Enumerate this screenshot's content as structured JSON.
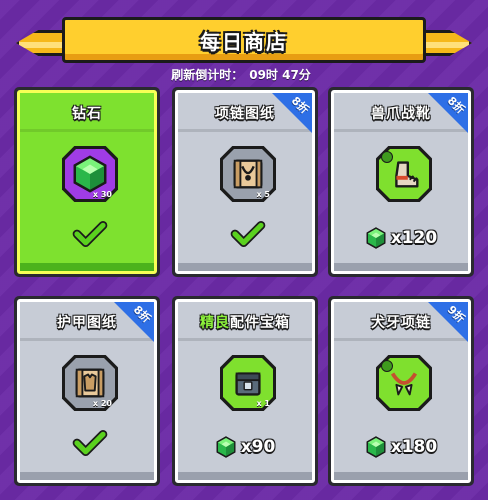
{
  "header": {
    "title": "每日商店",
    "refresh_label": "刷新倒计时：",
    "refresh_time": "09时 47分"
  },
  "colors": {
    "background": "#6b2aa6",
    "banner": "#ffcf2e",
    "selected_card": "#7ee12f",
    "card": "#c7ccd6",
    "discount_badge": "#2e6fe6"
  },
  "items": [
    {
      "title": "钻石",
      "quantity": "x 30",
      "icon": "gem-icon",
      "state": "claimed",
      "selected": true
    },
    {
      "title": "项链图纸",
      "quantity": "x 5",
      "icon": "necklace-blueprint-icon",
      "discount": "8折",
      "state": "claimed"
    },
    {
      "title": "兽爪战靴",
      "quantity": "",
      "icon": "claw-boots-icon",
      "discount": "8折",
      "price": "x120",
      "currency_icon": "gem-icon"
    },
    {
      "title": "护甲图纸",
      "quantity": "x 20",
      "icon": "armor-blueprint-icon",
      "discount": "8折",
      "state": "claimed"
    },
    {
      "title_highlight": "精良",
      "title": "配件宝箱",
      "quantity": "x 1",
      "icon": "accessory-chest-icon",
      "price": "x90",
      "currency_icon": "gem-icon"
    },
    {
      "title": "犬牙项链",
      "quantity": "",
      "icon": "fang-necklace-icon",
      "discount": "9折",
      "price": "x180",
      "currency_icon": "gem-icon"
    }
  ]
}
